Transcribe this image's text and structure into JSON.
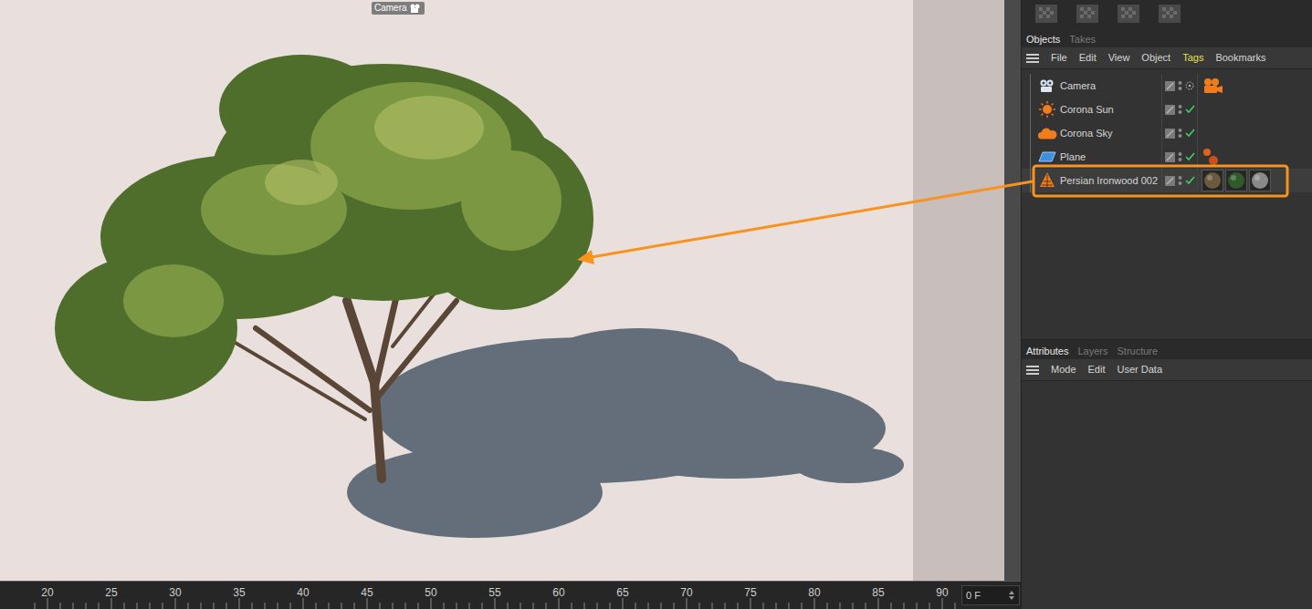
{
  "viewport": {
    "label": "Camera"
  },
  "objects_panel": {
    "tabs": [
      {
        "label": "Objects",
        "selected": true
      },
      {
        "label": "Takes",
        "selected": false
      }
    ],
    "menu": [
      {
        "label": "File",
        "active": false
      },
      {
        "label": "Edit",
        "active": false
      },
      {
        "label": "View",
        "active": false
      },
      {
        "label": "Object",
        "active": false
      },
      {
        "label": "Tags",
        "active": true
      },
      {
        "label": "Bookmarks",
        "active": false
      }
    ],
    "objects": [
      {
        "name": "Camera",
        "kind": "camera",
        "enabled": false,
        "highlighted": false,
        "tag_count": 1
      },
      {
        "name": "Corona Sun",
        "kind": "sun",
        "enabled": true,
        "highlighted": false,
        "tag_count": 0
      },
      {
        "name": "Corona Sky",
        "kind": "sky",
        "enabled": true,
        "highlighted": false,
        "tag_count": 0
      },
      {
        "name": "Plane",
        "kind": "plane",
        "enabled": true,
        "highlighted": false,
        "tag_count": 1
      },
      {
        "name": "Persian Ironwood 002",
        "kind": "tree",
        "enabled": true,
        "highlighted": true,
        "tag_count": 3
      }
    ]
  },
  "attributes_panel": {
    "tabs": [
      {
        "label": "Attributes",
        "selected": true
      },
      {
        "label": "Layers",
        "selected": false
      },
      {
        "label": "Structure",
        "selected": false
      }
    ],
    "menu": [
      "Mode",
      "Edit",
      "User Data"
    ]
  },
  "timeline": {
    "ticks": [
      "20",
      "25",
      "30",
      "35",
      "40",
      "45",
      "50",
      "55",
      "60",
      "65",
      "70",
      "75",
      "80",
      "85",
      "90"
    ],
    "frame": "0 F"
  }
}
